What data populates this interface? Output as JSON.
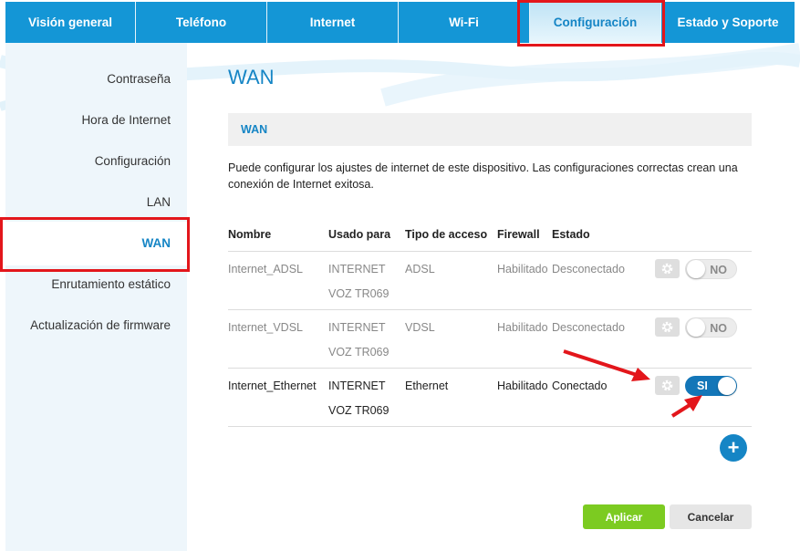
{
  "nav": {
    "tabs": [
      {
        "label": "Visión general"
      },
      {
        "label": "Teléfono"
      },
      {
        "label": "Internet"
      },
      {
        "label": "Wi-Fi"
      },
      {
        "label": "Configuración"
      },
      {
        "label": "Estado y Soporte"
      }
    ],
    "active": "Configuración"
  },
  "sidebar": {
    "items": [
      {
        "label": "Contraseña"
      },
      {
        "label": "Hora de Internet"
      },
      {
        "label": "Configuración"
      },
      {
        "label": "LAN"
      },
      {
        "label": "WAN"
      },
      {
        "label": "Enrutamiento estático"
      },
      {
        "label": "Actualización de firmware"
      }
    ],
    "active": "WAN"
  },
  "page": {
    "title": "WAN",
    "section_title": "WAN",
    "description": "Puede configurar los ajustes de internet de este dispositivo. Las configuraciones correctas crean una conexión de Internet exitosa."
  },
  "table": {
    "headers": [
      "Nombre",
      "Usado para",
      "Tipo de acceso",
      "Firewall",
      "Estado"
    ],
    "rows": [
      {
        "name": "Internet_ADSL",
        "used_for": "INTERNET",
        "used_for_2": "VOZ TR069",
        "access": "ADSL",
        "firewall": "Habilitado",
        "status": "Desconectado",
        "toggle": "NO",
        "enabled": false
      },
      {
        "name": "Internet_VDSL",
        "used_for": "INTERNET",
        "used_for_2": "VOZ TR069",
        "access": "VDSL",
        "firewall": "Habilitado",
        "status": "Desconectado",
        "toggle": "NO",
        "enabled": false
      },
      {
        "name": "Internet_Ethernet",
        "used_for": "INTERNET",
        "used_for_2": "VOZ TR069",
        "access": "Ethernet",
        "firewall": "Habilitado",
        "status": "Conectado",
        "toggle": "SI",
        "enabled": true
      }
    ]
  },
  "actions": {
    "add_icon": "+",
    "apply": "Aplicar",
    "cancel": "Cancelar"
  },
  "icons": {
    "gear": "gear-icon",
    "add": "plus-icon"
  },
  "colors": {
    "brand_blue": "#1496d6",
    "title_blue": "#1585c5",
    "toggle_on": "#1376b8",
    "apply_green": "#7ccb21",
    "annotation_red": "#e3161b"
  }
}
